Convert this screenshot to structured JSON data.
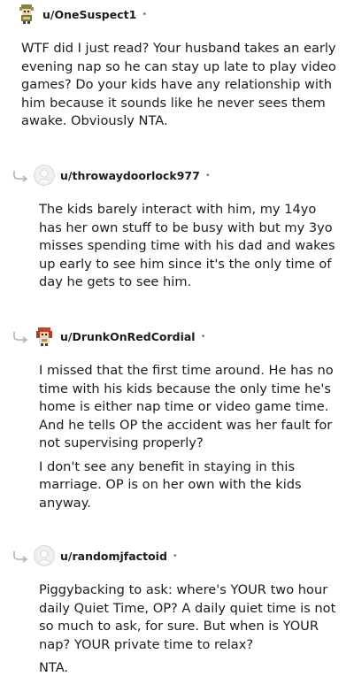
{
  "comments": [
    {
      "username": "u/OneSuspect1",
      "separator": "•",
      "avatar_icon": "pixel-character-avatar",
      "is_reply": false,
      "paragraphs": [
        "WTF did I just read? Your husband takes an early evening nap so he can stay up late to play video games? Do your kids have any relationship with him because it sounds like he never sees them awake. Obviously NTA."
      ]
    },
    {
      "username": "u/throwaydoorlock977",
      "separator": "•",
      "avatar_icon": "default-avatar",
      "is_reply": true,
      "paragraphs": [
        "The kids barely interact with him, my 14yo has her own stuff to be busy with but my 3yo misses spending time with his dad and wakes up early to see him since it's the only time of day he gets to see him."
      ]
    },
    {
      "username": "u/DrunkOnRedCordial",
      "separator": "•",
      "avatar_icon": "red-haired-character-avatar",
      "is_reply": true,
      "paragraphs": [
        "I missed that the first time around. He has no time with his kids because the only time he's home is either nap time or video game time. And he tells OP the accident was her fault for not supervising properly?",
        "I don't see any benefit in staying in this marriage. OP is on her own with the kids anyway."
      ]
    },
    {
      "username": "u/randomjfactoid",
      "separator": "•",
      "avatar_icon": "default-avatar",
      "is_reply": true,
      "paragraphs": [
        "Piggybacking to ask: where's YOUR two hour daily Quiet Time, OP? A daily quiet time is not so much to ask, for sure. But when is YOUR nap? YOUR private time to relax?",
        "NTA."
      ]
    }
  ]
}
